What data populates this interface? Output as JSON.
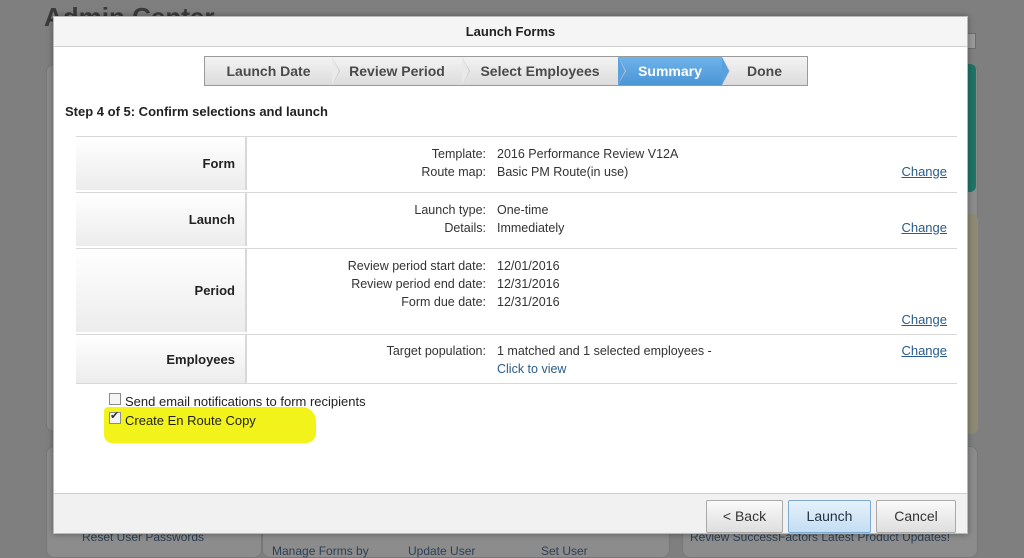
{
  "background": {
    "title": "Admin Center",
    "links": [
      "Reset User Passwords",
      "Manage Forms by",
      "Update User",
      "Set User",
      "Review SuccessFactors Latest Product Updates!"
    ]
  },
  "modal": {
    "title": "Launch Forms",
    "steps": [
      "Launch Date",
      "Review Period",
      "Select Employees",
      "Summary",
      "Done"
    ],
    "active_step": "Summary",
    "step_title": "Step 4 of 5: Confirm selections and launch",
    "change_label": "Change",
    "rows": {
      "form": {
        "label": "Form",
        "template_key": "Template:",
        "template_value": "2016 Performance Review V12A",
        "route_key": "Route map:",
        "route_value": "Basic PM Route(in use)"
      },
      "launch": {
        "label": "Launch",
        "type_key": "Launch type:",
        "type_value": "One-time",
        "details_key": "Details:",
        "details_value": "Immediately"
      },
      "period": {
        "label": "Period",
        "start_key": "Review period start date:",
        "start_value": "12/01/2016",
        "end_key": "Review period end date:",
        "end_value": "12/31/2016",
        "due_key": "Form due date:",
        "due_value": "12/31/2016"
      },
      "employees": {
        "label": "Employees",
        "target_key": "Target population:",
        "target_value": "1 matched and 1 selected employees -",
        "view_link": "Click to view"
      }
    },
    "options": {
      "email_label": "Send email notifications to form recipients",
      "email_checked": false,
      "enroute_label": "Create En Route Copy",
      "enroute_checked": true
    },
    "buttons": {
      "back": "< Back",
      "launch": "Launch",
      "cancel": "Cancel"
    }
  },
  "colors": {
    "active_step": "#5aa2df",
    "link": "#2a5c8a",
    "highlight": "#f3f31c"
  }
}
